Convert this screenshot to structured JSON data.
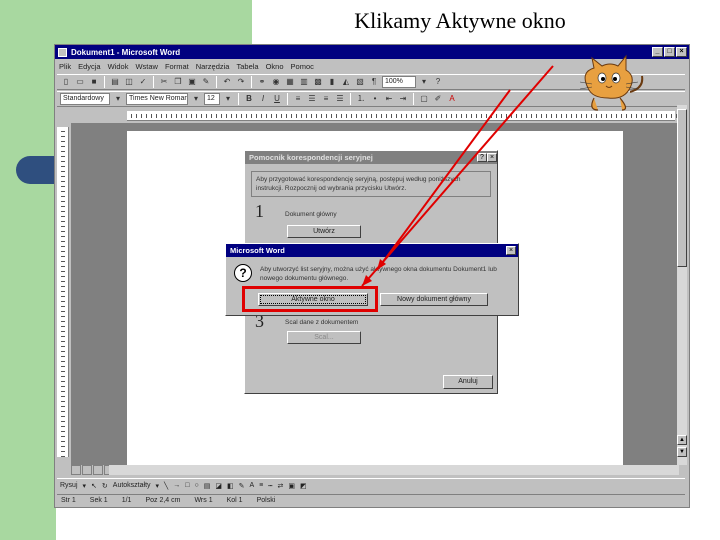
{
  "slide": {
    "title": "Klikamy Aktywne okno",
    "accent": "#e00000"
  },
  "window": {
    "title": "Dokument1 - Microsoft Word",
    "buttons": [
      "_",
      "□",
      "×"
    ]
  },
  "menu": [
    "Plik",
    "Edycja",
    "Widok",
    "Wstaw",
    "Format",
    "Narzędzia",
    "Tabela",
    "Okno",
    "Pomoc"
  ],
  "toolbar": {
    "zoom": "100%",
    "style": "Standardowy",
    "font": "Times New Roman",
    "size": "12"
  },
  "drawing": {
    "draw_label": "Rysuj",
    "autoshapes_label": "Autokształty"
  },
  "status": {
    "page": "Str 1",
    "section": "Sek 1",
    "pages": "1/1",
    "position": "Poz 2,4 cm",
    "line": "Wrs 1",
    "col": "Kol 1",
    "lang": "Polski"
  },
  "merge_dialog": {
    "title": "Pomocnik korespondencji seryjnej",
    "info": "Aby przygotować korespondencję seryjną, postępuj według poniższych instrukcji. Rozpocznij od wybrania przycisku Utwórz.",
    "step1_num": "1",
    "step1_label": "Dokument główny",
    "step1_button": "Utwórz",
    "step3_num": "3",
    "step3_label": "Scal dane z dokumentem",
    "step3_button": "Scal...",
    "cancel_button": "Anuluj"
  },
  "msword_dialog": {
    "title": "Microsoft Word",
    "message": "Aby utworzyć list seryjny, można użyć aktywnego okna dokumentu Dokument1 lub nowego dokumentu głównego.",
    "active_button": "Aktywne okno",
    "new_button": "Nowy dokument główny"
  }
}
